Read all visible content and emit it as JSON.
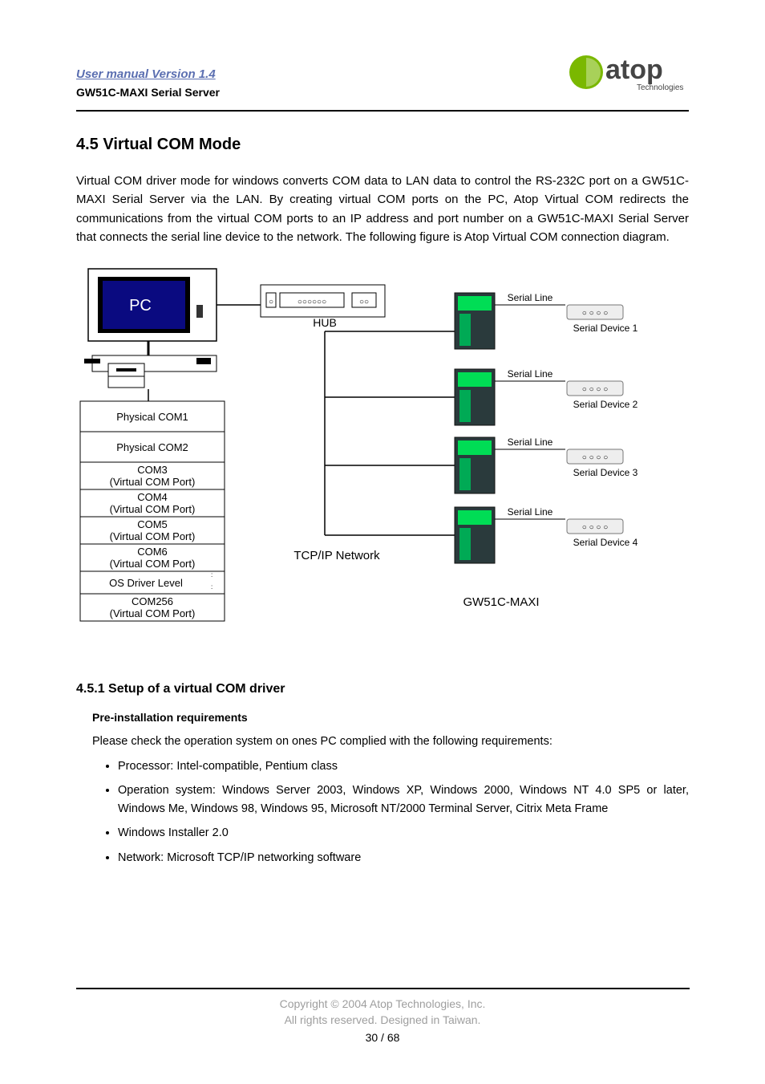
{
  "header": {
    "manual": "User manual Version 1.4",
    "product": "GW51C-MAXI Serial Server",
    "logo_main": "atop",
    "logo_sub": "Technologies"
  },
  "section": {
    "number_title": "4.5 Virtual COM Mode",
    "paragraph": "Virtual COM driver mode for windows converts COM data to LAN data to control the RS-232C port on a GW51C-MAXI Serial Server via the LAN. By creating virtual COM ports on the PC, Atop Virtual COM redirects the communications from the virtual COM ports to an IP address and port number on a GW51C-MAXI Serial Server that connects the serial line device to the network. The following figure is Atop Virtual COM connection diagram."
  },
  "diagram": {
    "pc": "PC",
    "hub": "HUB",
    "ports": [
      "Physical COM1",
      "Physical COM2",
      "COM3",
      "(Virtual COM Port)",
      "COM4",
      "(Virtual COM Port)",
      "COM5",
      "(Virtual COM Port)",
      "COM6",
      "(Virtual COM Port)",
      "OS Driver Level",
      "COM256",
      "(Virtual COM Port)"
    ],
    "network_label": "TCP/IP Network",
    "gw_label": "GW51C-MAXI",
    "serial_line_label": "Serial Line",
    "serial_devices": [
      "Serial Device 1",
      "Serial Device 2",
      "Serial Device 3",
      "Serial Device 4"
    ]
  },
  "subsection": {
    "title": "4.5.1 Setup of a virtual COM driver",
    "preheading": "Pre-installation requirements",
    "intro": "Please check the operation system on ones PC complied with the following requirements:",
    "bullets": [
      "Processor: Intel-compatible, Pentium class",
      "Operation system: Windows Server 2003, Windows XP, Windows 2000, Windows NT 4.0 SP5 or later, Windows Me, Windows 98, Windows 95, Microsoft NT/2000 Terminal Server, Citrix Meta Frame",
      "Windows Installer 2.0",
      "Network: Microsoft TCP/IP networking software"
    ]
  },
  "footer": {
    "copyright": "Copyright © 2004 Atop Technologies, Inc.",
    "rights": "All rights reserved. Designed in Taiwan.",
    "page": "30 / 68"
  }
}
